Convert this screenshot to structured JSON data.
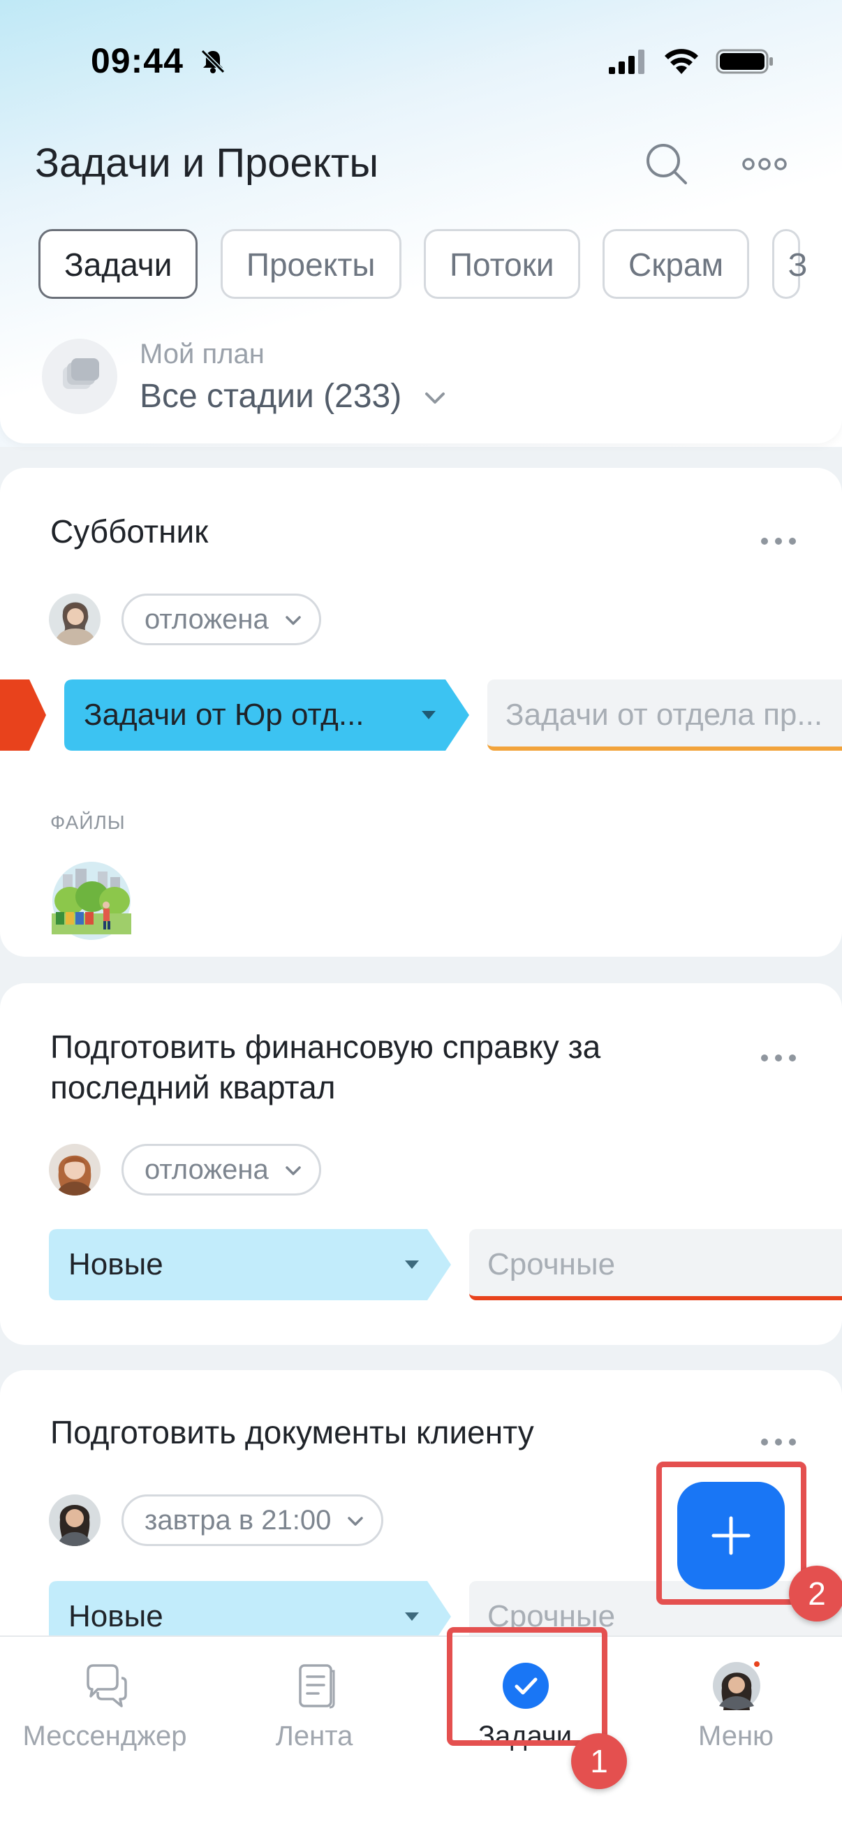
{
  "status_bar": {
    "time": "09:44"
  },
  "header": {
    "title": "Задачи и Проекты",
    "tabs": [
      {
        "label": "Задачи",
        "active": true
      },
      {
        "label": "Проекты",
        "active": false
      },
      {
        "label": "Потоки",
        "active": false
      },
      {
        "label": "Скрам",
        "active": false
      },
      {
        "label": "З",
        "active": false
      }
    ],
    "plan": {
      "label": "Мой план",
      "value": "Все стадии (233)"
    }
  },
  "tasks": [
    {
      "title": "Субботник",
      "deadline": "отложена",
      "stage": "Задачи от Юр отд...",
      "next_stage": "Задачи от отдела пр...",
      "files_label": "ФАЙЛЫ"
    },
    {
      "title": "Подготовить финансовую справку за последний квартал",
      "deadline": "отложена",
      "stage": "Новые",
      "next_stage": "Срочные"
    },
    {
      "title": "Подготовить документы клиенту",
      "deadline": "завтра в 21:00",
      "stage": "Новые",
      "next_stage": "Срочные"
    }
  ],
  "fab": {
    "icon": "plus-icon",
    "color": "#1976f5"
  },
  "annotations": {
    "badge_1": "1",
    "badge_2": "2",
    "color": "#e4504f"
  },
  "bottom_nav": [
    {
      "label": "Мессенджер",
      "icon": "chat-icon",
      "active": false
    },
    {
      "label": "Лента",
      "icon": "feed-icon",
      "active": false
    },
    {
      "label": "Задачи",
      "icon": "check-circle-icon",
      "active": true
    },
    {
      "label": "Меню",
      "icon": "avatar",
      "active": false
    }
  ],
  "colors": {
    "stage_cyan": "#3cc3f2",
    "stage_light": "#c2ecfb",
    "accent_orange": "#f2a33b",
    "accent_red": "#e8421c",
    "primary": "#1976f5"
  }
}
